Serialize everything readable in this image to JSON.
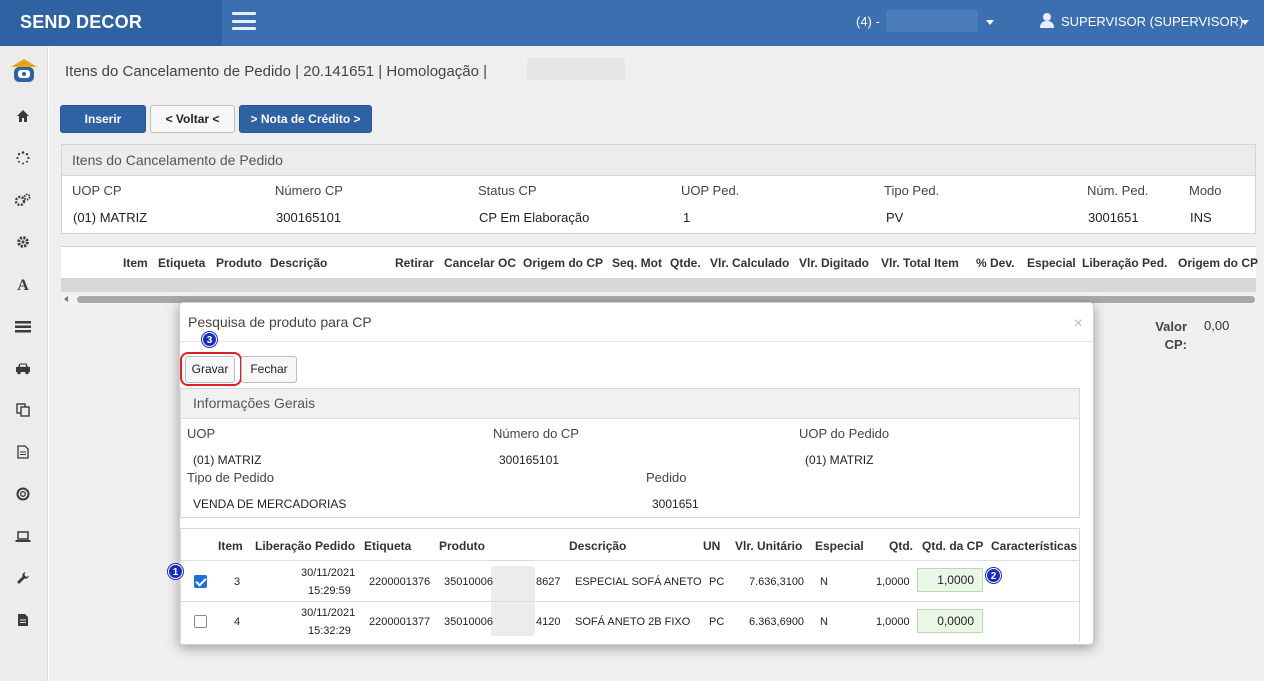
{
  "app": {
    "brand": "SEND DECOR",
    "company_prefix": "(4) -",
    "user": "SUPERVISOR (SUPERVISOR)"
  },
  "page": {
    "title": "Itens do Cancelamento de Pedido | 20.141651 | Homologação |"
  },
  "toolbar": {
    "insert_label": "Inserir",
    "back_label": "< Voltar <",
    "credit_note_label": "> Nota de Crédito >"
  },
  "header_panel": {
    "title": "Itens do Cancelamento de Pedido",
    "uop_cp_label": "UOP CP",
    "uop_cp": "(01) MATRIZ",
    "numero_cp_label": "Número CP",
    "numero_cp": "300165101",
    "status_cp_label": "Status CP",
    "status_cp": "CP Em Elaboração",
    "uop_ped_label": "UOP Ped.",
    "uop_ped": "1",
    "tipo_ped_label": "Tipo Ped.",
    "tipo_ped": "PV",
    "num_ped_label": "Núm. Ped.",
    "num_ped": "3001651",
    "modo_label": "Modo",
    "modo": "INS"
  },
  "grid": {
    "columns": [
      "Item",
      "Etiqueta",
      "Produto",
      "Descrição",
      "Retirar",
      "Cancelar OC",
      "Origem do CP",
      "Seq. Mot",
      "Qtde.",
      "Vlr. Calculado",
      "Vlr. Digitado",
      "Vlr. Total Item",
      "% Dev.",
      "Especial",
      "Liberação Ped.",
      "Origem do CP"
    ]
  },
  "totals": {
    "valor_cp_label": "Valor CP:",
    "valor_cp": "0,00"
  },
  "modal": {
    "title": "Pesquisa de produto para CP",
    "close_symbol": "×",
    "save_label": "Gravar",
    "close_label": "Fechar",
    "info_title": "Informações Gerais",
    "uop_label": "UOP",
    "uop": "(01) MATRIZ",
    "numero_cp_label": "Número do CP",
    "numero_cp": "300165101",
    "uop_pedido_label": "UOP do Pedido",
    "uop_pedido": "(01) MATRIZ",
    "tipo_pedido_label": "Tipo de Pedido",
    "tipo_pedido": "VENDA DE MERCADORIAS",
    "pedido_label": "Pedido",
    "pedido": "3001651",
    "columns": {
      "item": "Item",
      "liberacao": "Liberação Pedido",
      "etiqueta": "Etiqueta",
      "produto": "Produto",
      "descricao": "Descrição",
      "un": "UN",
      "vlr_unitario": "Vlr. Unitário",
      "especial": "Especial",
      "qtd": "Qtd.",
      "qtd_cp": "Qtd. da CP",
      "caracteristicas": "Características"
    },
    "rows": [
      {
        "checked": true,
        "item": "3",
        "lib_date": "30/11/2021",
        "lib_time": "15:29:59",
        "etiqueta": "2200001376",
        "produto_start": "35010006",
        "produto_end": "8627",
        "descricao": "ESPECIAL SOFÁ ANETO",
        "un": "PC",
        "vlr_unitario": "7.636,3100",
        "especial": "N",
        "qtd": "1,0000",
        "qtd_cp": "1,0000"
      },
      {
        "checked": false,
        "item": "4",
        "lib_date": "30/11/2021",
        "lib_time": "15:32:29",
        "etiqueta": "2200001377",
        "produto_start": "35010006",
        "produto_end": "4120",
        "descricao": "SOFÁ ANETO 2B FIXO",
        "un": "PC",
        "vlr_unitario": "6.363,6900",
        "especial": "N",
        "qtd": "1,0000",
        "qtd_cp": "0,0000"
      }
    ]
  },
  "annotations": {
    "badge_1": "1",
    "badge_2": "2",
    "badge_3": "3"
  },
  "colors": {
    "topbar": "#3b6fb0",
    "brand_bg": "#2f62a3",
    "primary_button": "#2f62a3",
    "highlight": "#d8232a",
    "badge": "#1a2fb8",
    "qty_field": "#ebf7e6"
  }
}
